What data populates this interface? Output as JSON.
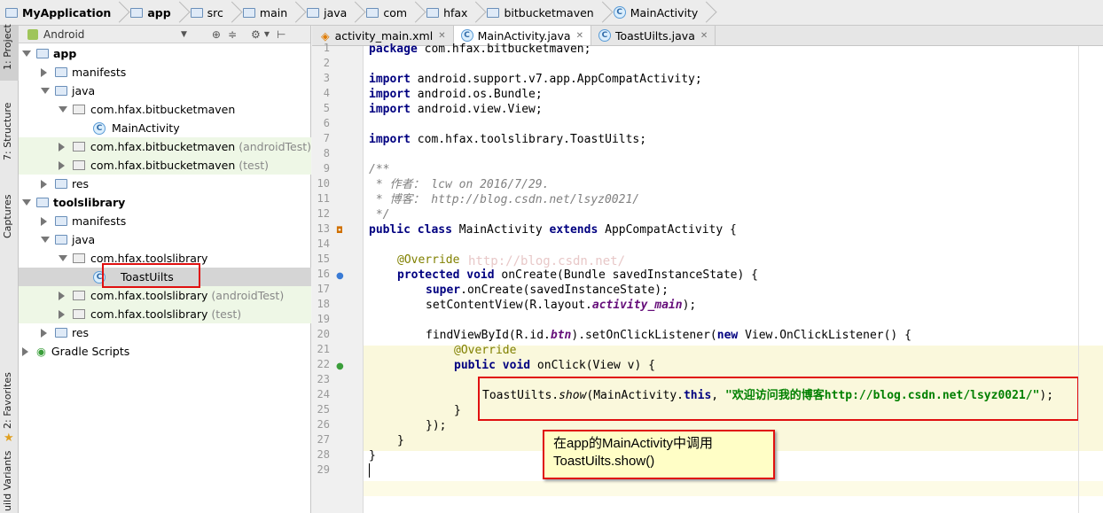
{
  "breadcrumb": [
    "MyApplication",
    "app",
    "src",
    "main",
    "java",
    "com",
    "hfax",
    "bitbucketmaven",
    "MainActivity"
  ],
  "sidebar_tabs": {
    "project": "1: Project",
    "structure": "7: Structure",
    "captures": "Captures",
    "favorites": "2: Favorites",
    "variants": "uild Variants"
  },
  "project": {
    "view_label": "Android",
    "tree": [
      {
        "label": "app",
        "extra": ""
      },
      {
        "label": "manifests",
        "extra": ""
      },
      {
        "label": "java",
        "extra": ""
      },
      {
        "label": "com.hfax.bitbucketmaven",
        "extra": ""
      },
      {
        "label": "MainActivity",
        "extra": ""
      },
      {
        "label": "com.hfax.bitbucketmaven",
        "extra": "(androidTest)"
      },
      {
        "label": "com.hfax.bitbucketmaven",
        "extra": "(test)"
      },
      {
        "label": "res",
        "extra": ""
      },
      {
        "label": "toolslibrary",
        "extra": ""
      },
      {
        "label": "manifests",
        "extra": ""
      },
      {
        "label": "java",
        "extra": ""
      },
      {
        "label": "com.hfax.toolslibrary",
        "extra": ""
      },
      {
        "label": "ToastUilts",
        "extra": ""
      },
      {
        "label": "com.hfax.toolslibrary",
        "extra": "(androidTest)"
      },
      {
        "label": "com.hfax.toolslibrary",
        "extra": "(test)"
      },
      {
        "label": "res",
        "extra": ""
      },
      {
        "label": "Gradle Scripts",
        "extra": ""
      }
    ]
  },
  "editor": {
    "tabs": [
      "activity_main.xml",
      "MainActivity.java",
      "ToastUilts.java"
    ],
    "line_numbers": [
      "1",
      "2",
      "3",
      "4",
      "5",
      "6",
      "7",
      "8",
      "9",
      "10",
      "11",
      "12",
      "13",
      "14",
      "15",
      "16",
      "17",
      "18",
      "19",
      "20",
      "21",
      "22",
      "23",
      "24",
      "25",
      "26",
      "27",
      "28",
      "29"
    ],
    "code": {
      "l1a": "package ",
      "l1b": "com.hfax.bitbucketmaven;",
      "l3a": "import ",
      "l3b": "android.support.v7.app.AppCompatActivity;",
      "l4a": "import ",
      "l4b": "android.os.Bundle;",
      "l5a": "import ",
      "l5b": "android.view.View;",
      "l7a": "import ",
      "l7b": "com.hfax.toolslibrary.ToastUilts;",
      "l9": "/**",
      "l10": " * 作者： lcw on 2016/7/29.",
      "l11": " * 博客： http://blog.csdn.net/lsyz0021/",
      "l12": " */",
      "l13a": "public class ",
      "l13b": "MainActivity ",
      "l13c": "extends ",
      "l13d": "AppCompatActivity {",
      "l15": "@Override",
      "l16a": "protected void ",
      "l16b": "onCreate(Bundle savedInstanceState) {",
      "l17a": "super",
      ".l17b": "",
      "l17": ".onCreate(savedInstanceState);",
      "l18a": "setContentView(R.layout.",
      "l18b": "activity_main",
      "l18c": ");",
      "l20a": "findViewById(R.id.",
      "l20b": "btn",
      "l20c": ").setOnClickListener(",
      "l20d": "new ",
      "l20e": "View.OnClickListener() {",
      "l21": "@Override",
      "l22a": "public void ",
      "l22b": "onClick(View v) {",
      "l24a": "ToastUilts.",
      "l24b": "show",
      "l24c": "(MainActivity.",
      "l24d": "this",
      "l24e": ", ",
      "l24f": "\"欢迎访问我的博客http://blog.csdn.net/lsyz0021/\"",
      "l24g": ");",
      "l25": "}",
      "l26": "});",
      "l27": "}",
      "l28": "}",
      "watermark": "http://blog.csdn.net/"
    }
  },
  "callout": {
    "line1": "在app的MainActivity中调用",
    "line2": "ToastUilts.show()"
  }
}
